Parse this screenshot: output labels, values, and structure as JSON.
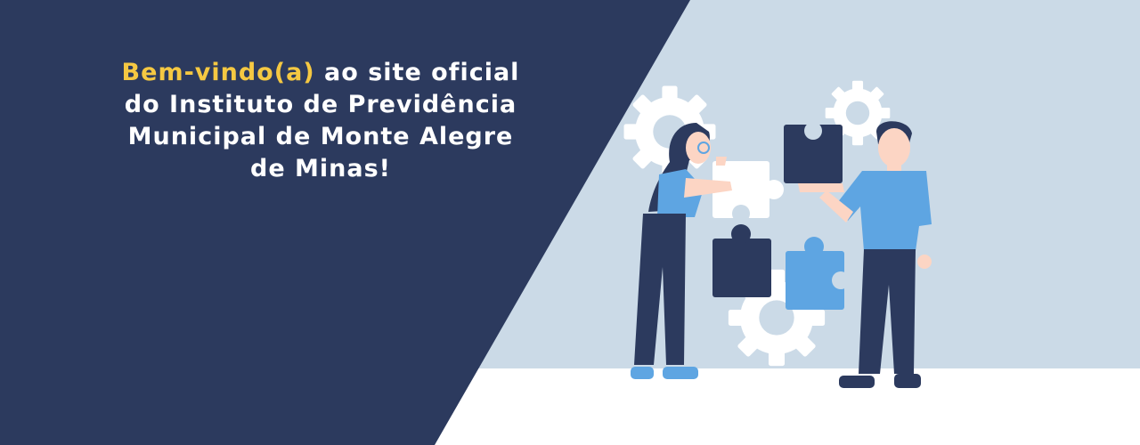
{
  "banner": {
    "headline_highlight": "Bem-vindo(a)",
    "headline_line1_rest": " ao site oficial",
    "headline_line2": "do Instituto de Previdência",
    "headline_line3": "Municipal de Monte Alegre",
    "headline_line4": "de Minas!"
  },
  "colors": {
    "navy": "#2c3a5e",
    "light_blue_bg": "#cbdae7",
    "accent_yellow": "#f5c842",
    "shirt_blue": "#5ea5e2",
    "gear_white": "#ffffff"
  },
  "illustration": {
    "icons": [
      "gear-icon",
      "puzzle-piece-icon",
      "woman-figure",
      "man-figure"
    ]
  }
}
